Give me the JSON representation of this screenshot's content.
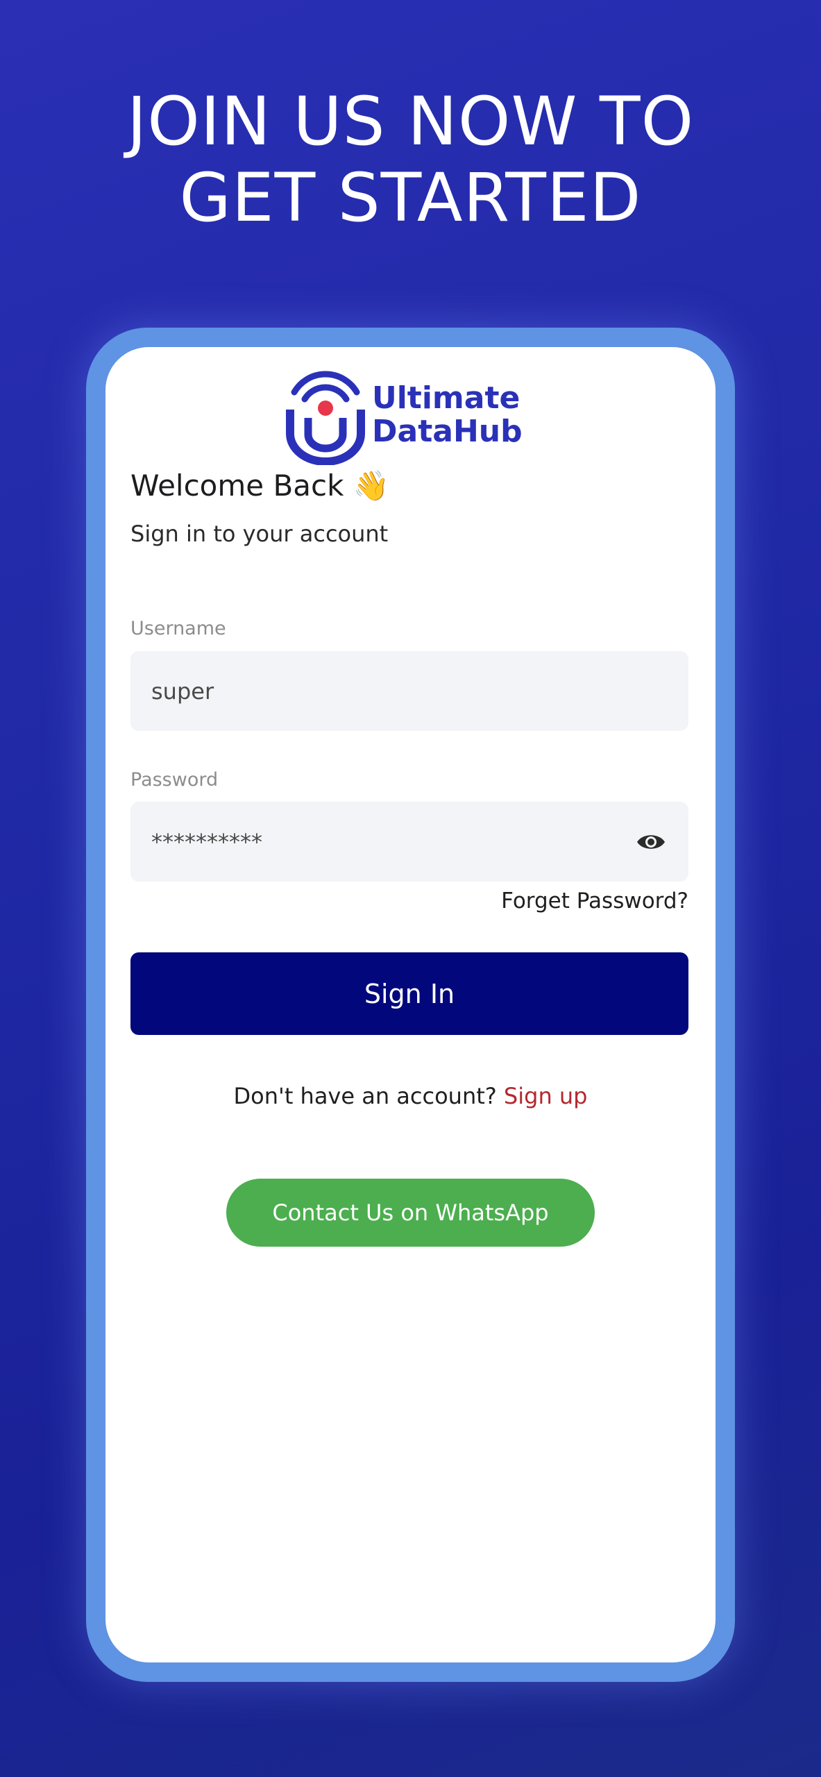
{
  "headline": {
    "line1": "JOIN US NOW TO",
    "line2": "GET STARTED"
  },
  "logo": {
    "line1": "Ultimate",
    "line2": "DataHub",
    "icon": "u-wifi-logo-icon",
    "colors": {
      "primary": "#2a31b8",
      "accent": "#e8364b"
    }
  },
  "login": {
    "welcome": "Welcome Back 👋",
    "subtitle": "Sign in to your account",
    "username_label": "Username",
    "username_value": "super",
    "password_label": "Password",
    "password_value": "**********",
    "password_toggle_icon": "eye-icon",
    "forget_password": "Forget Password?",
    "signin_label": "Sign In",
    "no_account_text": "Don't have an account?",
    "signup_link": "Sign up",
    "whatsapp_label": "Contact Us on WhatsApp"
  },
  "colors": {
    "background": "#2229a8",
    "frame": "#5f93e3",
    "signin_button": "#02087c",
    "whatsapp_button": "#4cae4f",
    "signup_link": "#b3282f"
  }
}
